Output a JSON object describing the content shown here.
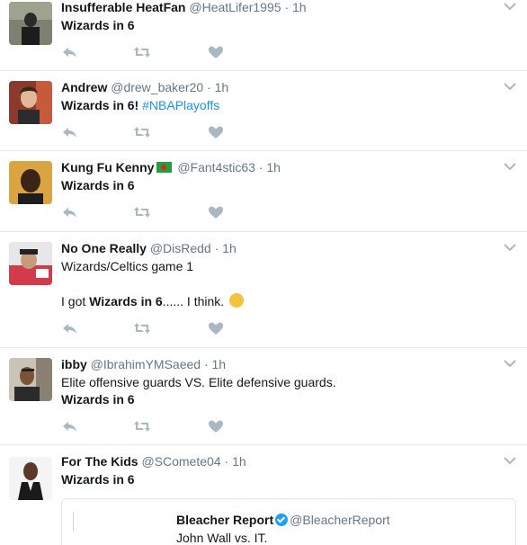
{
  "colors": {
    "name": "#14171a",
    "muted": "#657786",
    "link": "#1b95e0",
    "divider": "#e6ecf0",
    "icon": "#aab8c2"
  },
  "tweets": [
    {
      "name": "Insufferable HeatFan",
      "handle": "@HeatLifer1995",
      "dot": "·",
      "time": "1h",
      "line1_bold": "Wizards in 6"
    },
    {
      "name": "Andrew",
      "handle": "@drew_baker20",
      "dot": "·",
      "time": "1h",
      "line1_bold": "Wizards in 6!",
      "hashtag": "#NBAPlayoffs"
    },
    {
      "name": "Kung Fu Kenny",
      "handle": "@Fant4stic63",
      "dot": "·",
      "time": "1h",
      "flag_icon": "flag-emoji",
      "line1_bold": "Wizards in 6"
    },
    {
      "name": "No One Really",
      "handle": "@DisRedd",
      "dot": "·",
      "time": "1h",
      "line1": "Wizards/Celtics game 1",
      "line2_pre": "I got",
      "line2_bold": "Wizards in 6",
      "line2_post": "...... I think.",
      "emoji_icon": "thinking-face-emoji"
    },
    {
      "name": "ibby",
      "handle": "@IbrahimYMSaeed",
      "dot": "·",
      "time": "1h",
      "line1": "Elite offensive guards VS. Elite defensive guards.",
      "line2_bold": "Wizards in 6"
    },
    {
      "name": "For The Kids",
      "handle": "@SComete04",
      "dot": "·",
      "time": "1h",
      "line1_bold": "Wizards in 6",
      "quote": {
        "name": "Bleacher Report",
        "handle": "@BleacherReport",
        "text": "John Wall vs. IT."
      }
    }
  ]
}
